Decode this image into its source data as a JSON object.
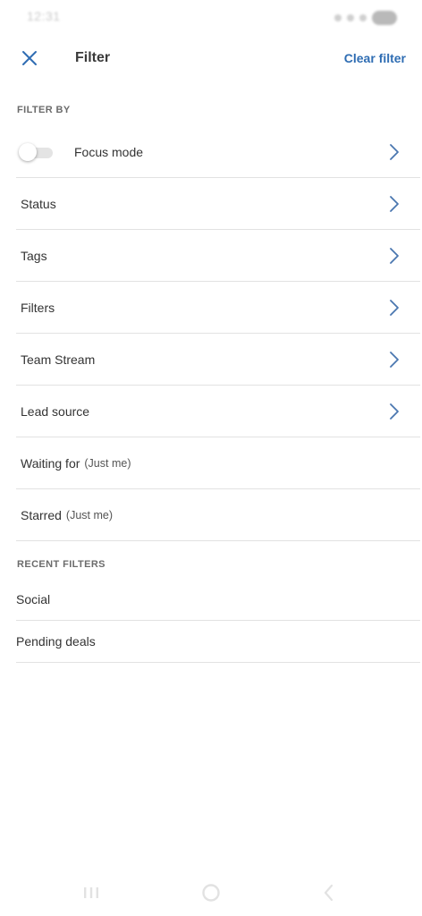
{
  "status_bar": {
    "time": "12:31"
  },
  "header": {
    "title": "Filter",
    "clear_label": "Clear filter",
    "close_icon": "close-icon"
  },
  "filter_by": {
    "section_title": "FILTER BY",
    "focus_mode": {
      "label": "Focus mode",
      "enabled": false
    },
    "items": [
      {
        "label": "Status",
        "suffix": "",
        "has_chevron": true
      },
      {
        "label": "Tags",
        "suffix": "",
        "has_chevron": true
      },
      {
        "label": "Filters",
        "suffix": "",
        "has_chevron": true
      },
      {
        "label": "Team Stream",
        "suffix": "",
        "has_chevron": true
      },
      {
        "label": "Lead source",
        "suffix": "",
        "has_chevron": true
      },
      {
        "label": "Waiting for",
        "suffix": "(Just me)",
        "has_chevron": false
      },
      {
        "label": "Starred",
        "suffix": "(Just me)",
        "has_chevron": false
      }
    ]
  },
  "recent_filters": {
    "section_title": "RECENT FILTERS",
    "items": [
      {
        "label": "Social"
      },
      {
        "label": "Pending deals"
      }
    ]
  },
  "colors": {
    "accent": "#2f6db3",
    "chevron": "#4a76b0",
    "divider": "#e2e2e2",
    "text": "#333333",
    "section": "#6b6b6b"
  },
  "nav_bar": {
    "icons": [
      "recent-apps-icon",
      "home-icon",
      "back-icon"
    ]
  }
}
